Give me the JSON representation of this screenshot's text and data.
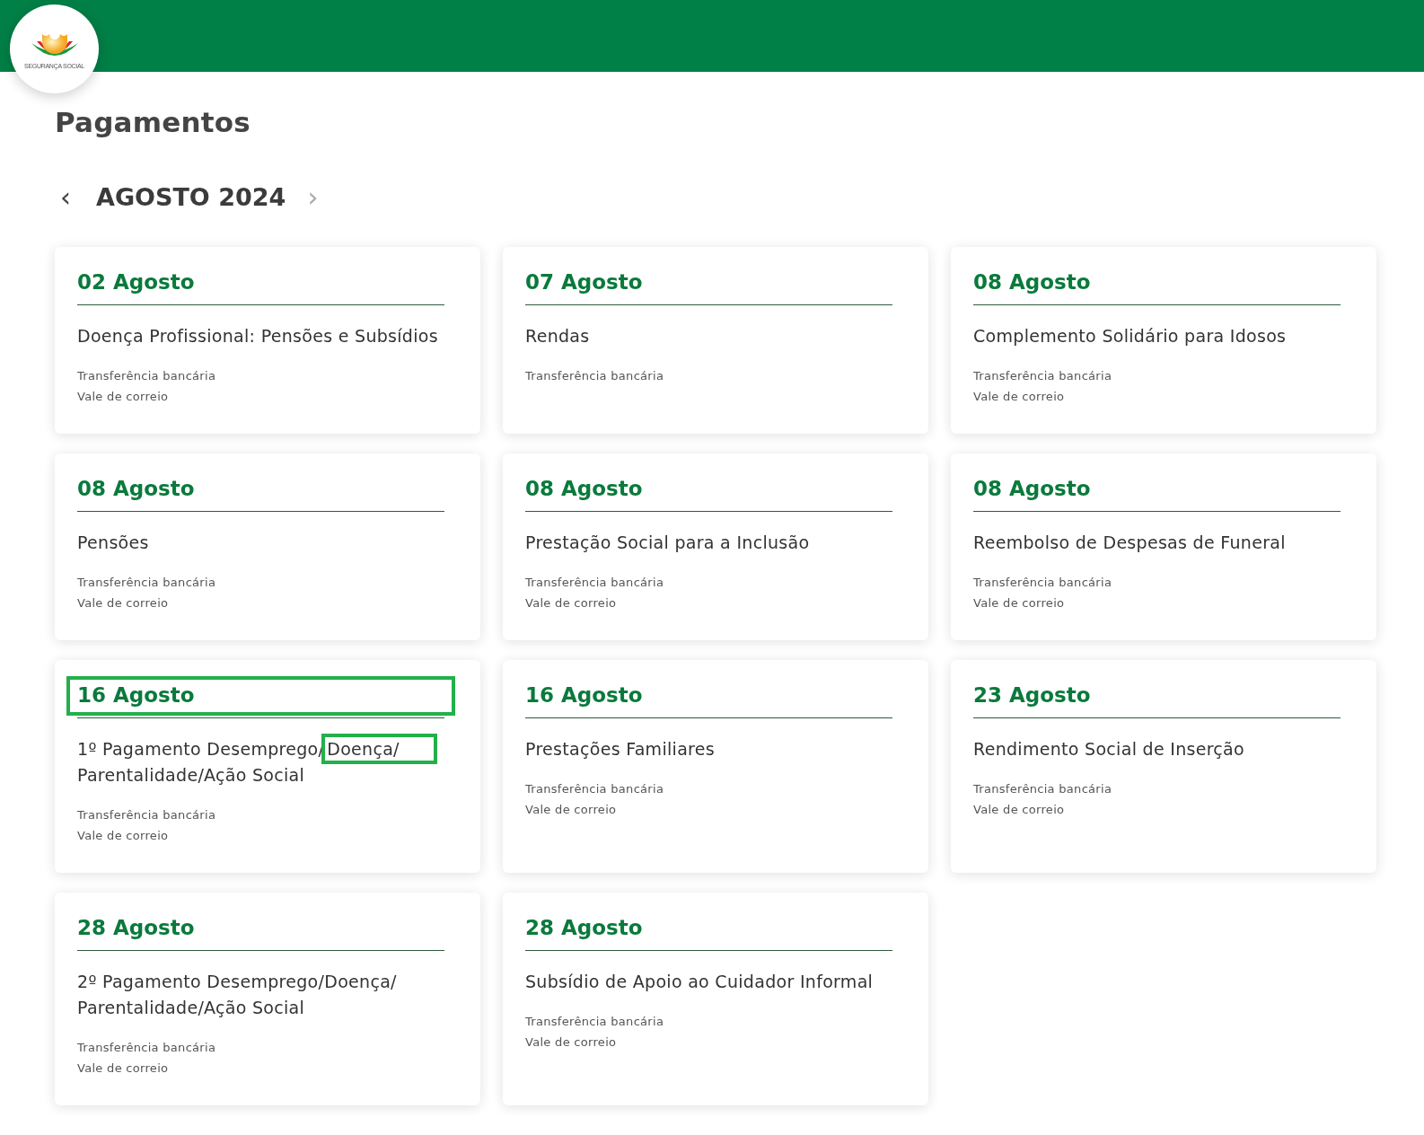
{
  "header": {
    "logo_text": "SEGURANÇA SOCIAL"
  },
  "page_title": "Pagamentos",
  "month_nav": {
    "label": "AGOSTO 2024",
    "prev": "‹",
    "next": "›"
  },
  "payments": [
    {
      "date": "02 Agosto",
      "date_highlighted": false,
      "title_segments": [
        {
          "text": "Doença Profissional: Pensões e Subsídios",
          "marked": false
        }
      ],
      "methods": [
        "Transferência bancária",
        "Vale de correio"
      ]
    },
    {
      "date": "07 Agosto",
      "date_highlighted": false,
      "title_segments": [
        {
          "text": "Rendas",
          "marked": false
        }
      ],
      "methods": [
        "Transferência bancária"
      ]
    },
    {
      "date": "08 Agosto",
      "date_highlighted": false,
      "title_segments": [
        {
          "text": "Complemento Solidário para Idosos",
          "marked": false
        }
      ],
      "methods": [
        "Transferência bancária",
        "Vale de correio"
      ]
    },
    {
      "date": "08 Agosto",
      "date_highlighted": false,
      "title_segments": [
        {
          "text": "Pensões",
          "marked": false
        }
      ],
      "methods": [
        "Transferência bancária",
        "Vale de correio"
      ]
    },
    {
      "date": "08 Agosto",
      "date_highlighted": false,
      "title_segments": [
        {
          "text": "Prestação Social para a Inclusão",
          "marked": false
        }
      ],
      "methods": [
        "Transferência bancária",
        "Vale de correio"
      ]
    },
    {
      "date": "08 Agosto",
      "date_highlighted": false,
      "title_segments": [
        {
          "text": "Reembolso de Despesas de Funeral",
          "marked": false
        }
      ],
      "methods": [
        "Transferência bancária",
        "Vale de correio"
      ]
    },
    {
      "date": "16 Agosto",
      "date_highlighted": true,
      "title_segments": [
        {
          "text": "1º Pagamento Desemprego/",
          "marked": false
        },
        {
          "text": "Doença/",
          "marked": true
        },
        {
          "text": " Parentalidade/Ação Social",
          "marked": false
        }
      ],
      "methods": [
        "Transferência bancária",
        "Vale de correio"
      ]
    },
    {
      "date": "16 Agosto",
      "date_highlighted": false,
      "title_segments": [
        {
          "text": "Prestações Familiares",
          "marked": false
        }
      ],
      "methods": [
        "Transferência bancária",
        "Vale de correio"
      ]
    },
    {
      "date": "23 Agosto",
      "date_highlighted": false,
      "title_segments": [
        {
          "text": "Rendimento Social de Inserção",
          "marked": false
        }
      ],
      "methods": [
        "Transferência bancária",
        "Vale de correio"
      ]
    },
    {
      "date": "28 Agosto",
      "date_highlighted": false,
      "title_segments": [
        {
          "text": "2º Pagamento Desemprego/Doença/ Parentalidade/Ação Social",
          "marked": false
        }
      ],
      "methods": [
        "Transferência bancária",
        "Vale de correio"
      ]
    },
    {
      "date": "28 Agosto",
      "date_highlighted": false,
      "title_segments": [
        {
          "text": "Subsídio de Apoio ao Cuidador Informal",
          "marked": false
        }
      ],
      "methods": [
        "Transferência bancária",
        "Vale de correio"
      ]
    }
  ]
}
